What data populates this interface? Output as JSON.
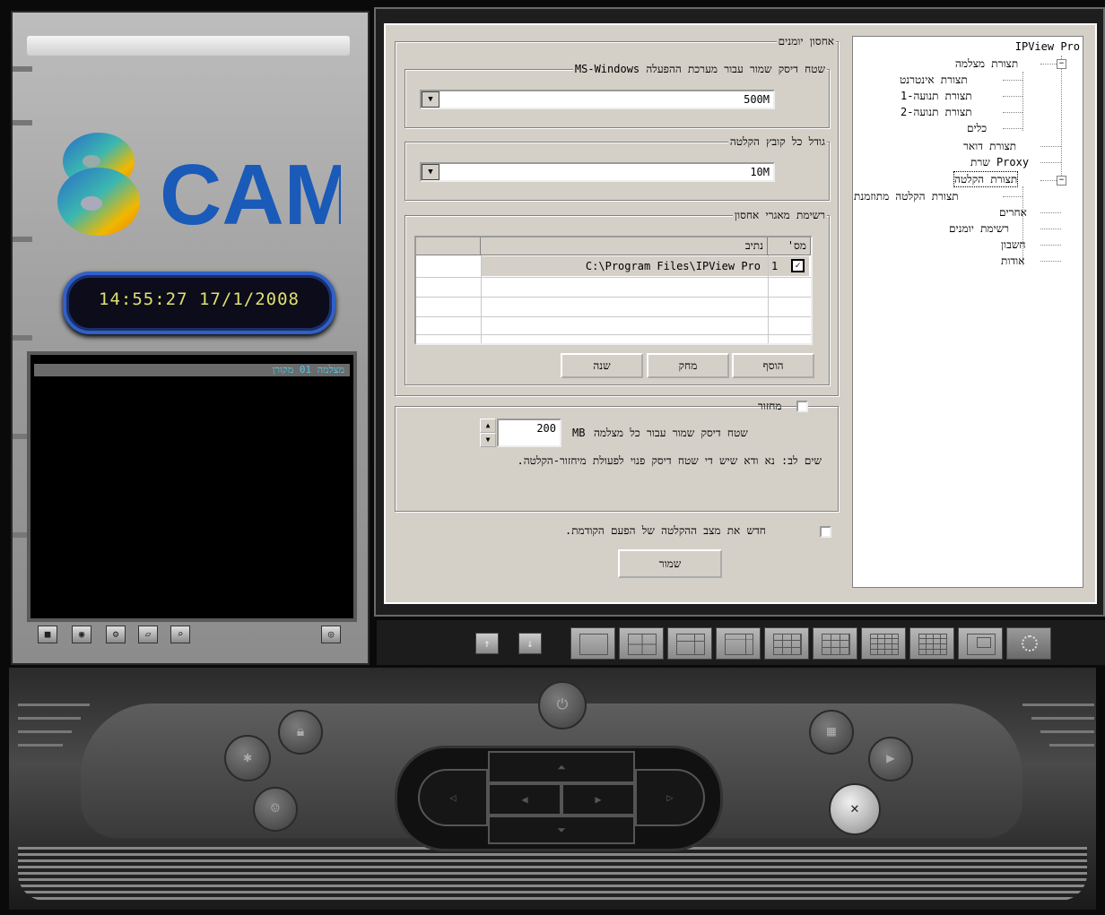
{
  "brand": {
    "logo_mark": "8",
    "logo_text": "CAM"
  },
  "clock": {
    "text": "14:55:27 17/1/2008"
  },
  "video": {
    "title": "מצלמה 01 מקורן"
  },
  "cam_icons": [
    "camera-icon",
    "audio-icon",
    "settings-icon",
    "folder-icon",
    "search-icon",
    "snapshot-icon"
  ],
  "tree": {
    "root": "IPView Pro",
    "items": [
      {
        "label": "תצורת מצלמה"
      },
      {
        "label": "תצורת אינטרנט"
      },
      {
        "label": "תצורת תנועה-1"
      },
      {
        "label": "תצורת תנועה-2"
      },
      {
        "label": "כלים"
      },
      {
        "label": "תצורת דואר"
      },
      {
        "label": "שרת Proxy"
      },
      {
        "label": "תצורת הקלטה"
      },
      {
        "label": "תצורת הקלטה מתוזמנת"
      },
      {
        "label": "אחרים"
      },
      {
        "label": "רשימת יומנים"
      },
      {
        "label": "חשבון"
      },
      {
        "label": "אודות"
      }
    ]
  },
  "log_storage": {
    "title": "אחסון יומנים",
    "os_space": {
      "label": "שטח דיסק שמור עבור מערכת ההפעלה MS-Windows",
      "value": "500M"
    },
    "file_size": {
      "label": "גודל כל קובץ הקלטה",
      "value": "10M"
    },
    "repo_list": {
      "label": "רשימת מאגרי אחסון",
      "columns": [
        "מס'",
        "נתיב"
      ],
      "rows": [
        {
          "num": "1",
          "path": "C:\\Program Files\\IPView Pro",
          "checked": true
        }
      ],
      "add_label": "הוסף",
      "delete_label": "מחק",
      "change_label": "שנה"
    }
  },
  "recycle": {
    "label": "מחזור",
    "space_label": "שטח דיסק שמור עבור כל מצלמה",
    "space_value": "200",
    "unit": "MB",
    "note": "שים לב: נא ודא שיש די שטח דיסק פנוי לפעולת מיחזור-הקלטה."
  },
  "resume": {
    "label": "חדש את מצב ההקלטה של הפעם הקודמת."
  },
  "save_label": "שמור",
  "toolbar": {
    "up_arrow": "↑",
    "down_arrow": "↓"
  }
}
